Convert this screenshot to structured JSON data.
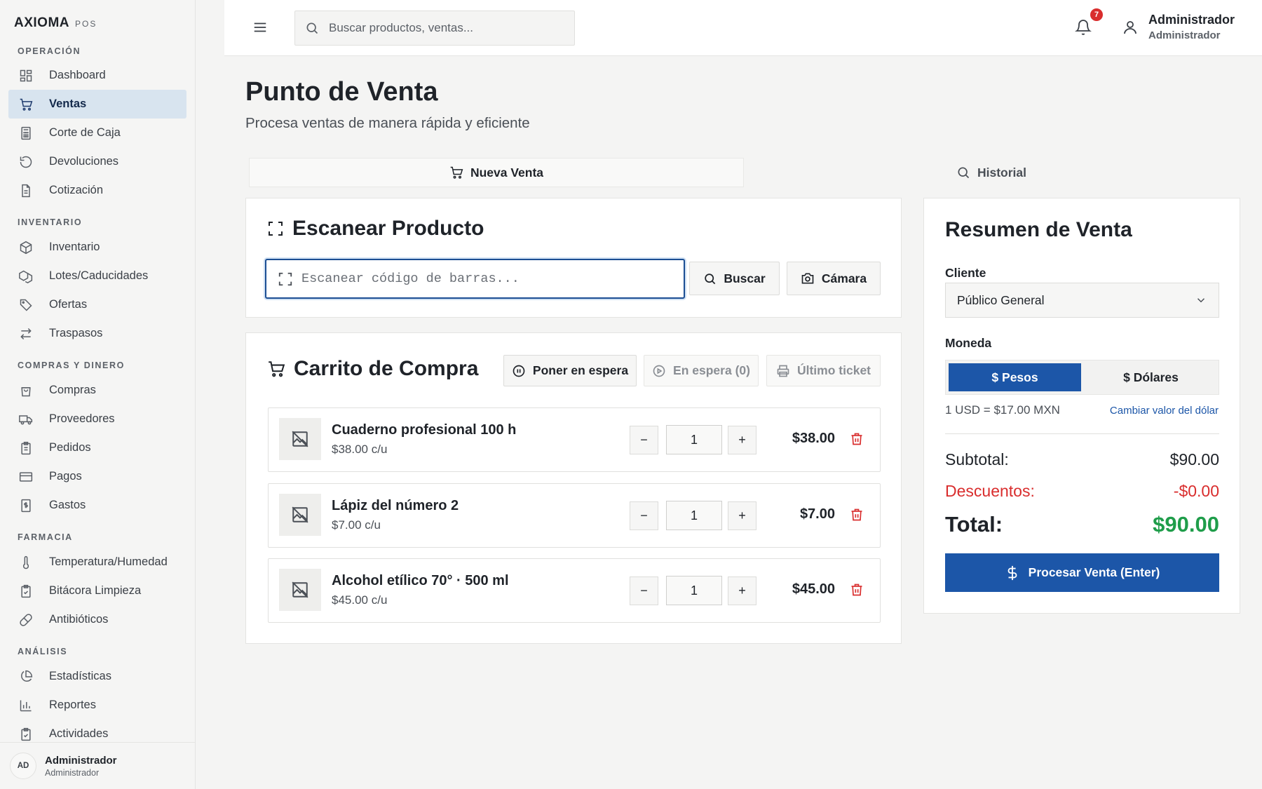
{
  "brand": {
    "name": "AXIOMA",
    "suffix": "POS"
  },
  "sidebar": {
    "sections": [
      {
        "label": "OPERACIÓN"
      },
      {
        "label": "INVENTARIO"
      },
      {
        "label": "COMPRAS Y DINERO"
      },
      {
        "label": "FARMACIA"
      },
      {
        "label": "ANÁLISIS"
      }
    ],
    "items": [
      {
        "label": "Dashboard",
        "icon": "dashboard-icon"
      },
      {
        "label": "Ventas",
        "icon": "cart-icon",
        "active": true
      },
      {
        "label": "Corte de Caja",
        "icon": "calculator-icon"
      },
      {
        "label": "Devoluciones",
        "icon": "undo-icon"
      },
      {
        "label": "Cotización",
        "icon": "document-icon"
      },
      {
        "label": "Inventario",
        "icon": "package-icon"
      },
      {
        "label": "Lotes/Caducidades",
        "icon": "packages-icon"
      },
      {
        "label": "Ofertas",
        "icon": "tag-icon"
      },
      {
        "label": "Traspasos",
        "icon": "transfer-icon"
      },
      {
        "label": "Compras",
        "icon": "shopping-bag-icon"
      },
      {
        "label": "Proveedores",
        "icon": "truck-icon"
      },
      {
        "label": "Pedidos",
        "icon": "clipboard-icon"
      },
      {
        "label": "Pagos",
        "icon": "credit-card-icon"
      },
      {
        "label": "Gastos",
        "icon": "receipt-icon"
      },
      {
        "label": "Temperatura/Humedad",
        "icon": "thermometer-icon"
      },
      {
        "label": "Bitácora Limpieza",
        "icon": "clipboard-check-icon"
      },
      {
        "label": "Antibióticos",
        "icon": "pill-icon"
      },
      {
        "label": "Estadísticas",
        "icon": "pie-chart-icon"
      },
      {
        "label": "Reportes",
        "icon": "bar-chart-icon"
      },
      {
        "label": "Actividades",
        "icon": "clipboard-list-icon"
      }
    ],
    "footer": {
      "initials": "AD",
      "name": "Administrador",
      "role": "Administrador"
    }
  },
  "header": {
    "search_placeholder": "Buscar productos, ventas...",
    "notifications_count": "7",
    "user_name": "Administrador",
    "user_role": "Administrador"
  },
  "page": {
    "title": "Punto de Venta",
    "subtitle": "Procesa ventas de manera rápida y eficiente"
  },
  "tabs": [
    {
      "label": "Nueva Venta",
      "active": true
    },
    {
      "label": "Historial",
      "active": false
    }
  ],
  "scan": {
    "title": "Escanear Producto",
    "placeholder": "Escanear código de barras...",
    "search_label": "Buscar",
    "camera_label": "Cámara"
  },
  "cart": {
    "title": "Carrito de Compra",
    "hold_label": "Poner en espera",
    "on_hold_label": "En espera (0)",
    "last_ticket_label": "Último ticket",
    "items": [
      {
        "name": "Cuaderno profesional 100 h",
        "unit_price": "$38.00 c/u",
        "qty": "1",
        "total": "$38.00"
      },
      {
        "name": "Lápiz del número 2",
        "unit_price": "$7.00 c/u",
        "qty": "1",
        "total": "$7.00"
      },
      {
        "name": "Alcohol etílico 70° · 500 ml",
        "unit_price": "$45.00 c/u",
        "qty": "1",
        "total": "$45.00"
      }
    ]
  },
  "summary": {
    "title": "Resumen de Venta",
    "client_label": "Cliente",
    "client_value": "Público General",
    "currency_label": "Moneda",
    "currency_options": [
      "$ Pesos",
      "$ Dólares"
    ],
    "exchange_rate": "1 USD = $17.00 MXN",
    "change_rate_link": "Cambiar valor del dólar",
    "subtotal_label": "Subtotal:",
    "subtotal_value": "$90.00",
    "discounts_label": "Descuentos:",
    "discounts_value": "-$0.00",
    "total_label": "Total:",
    "total_value": "$90.00",
    "process_label": "Procesar Venta (Enter)"
  },
  "colors": {
    "primary": "#1c56a8",
    "danger": "#d92d2d",
    "success": "#1f9d4a",
    "active_nav_bg": "#d8e4ef"
  }
}
